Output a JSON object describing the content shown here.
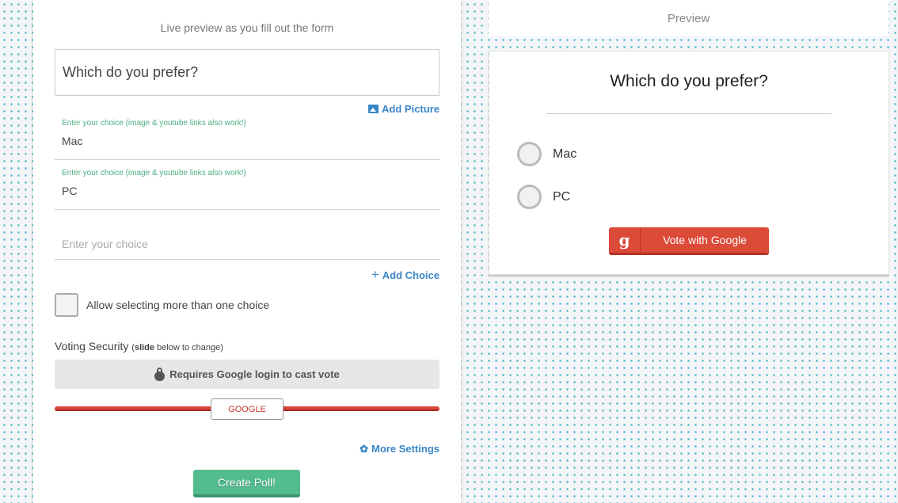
{
  "form": {
    "caption": "Live preview as you fill out the form",
    "question_value": "Which do you prefer?",
    "add_picture_label": "Add Picture",
    "choices": [
      {
        "hint": "Enter your choice (image & youtube links also work!)",
        "value": "Mac"
      },
      {
        "hint": "Enter your choice (image & youtube links also work!)",
        "value": "PC"
      }
    ],
    "empty_choice_placeholder": "Enter your choice",
    "add_choice_label": "Add Choice",
    "add_choice_icon": "+",
    "multi_select_label": "Allow selecting more than one choice",
    "multi_select_checked": false,
    "security": {
      "title": "Voting Security",
      "hint_prefix": "(",
      "hint_bold": "slide",
      "hint_rest": " below to change)",
      "description": "Requires Google login to cast vote",
      "slider_value": "GOOGLE",
      "slider_color": "#d9453a"
    },
    "more_settings_label": "More Settings",
    "gear_icon": "✿",
    "create_button_label": "Create Poll!",
    "create_button_color": "#52bc8f"
  },
  "preview": {
    "header": "Preview",
    "question": "Which do you prefer?",
    "options": [
      "Mac",
      "PC"
    ],
    "vote_button_icon": "g",
    "vote_button_label": "Vote with Google",
    "vote_button_color": "#dc4a38"
  }
}
